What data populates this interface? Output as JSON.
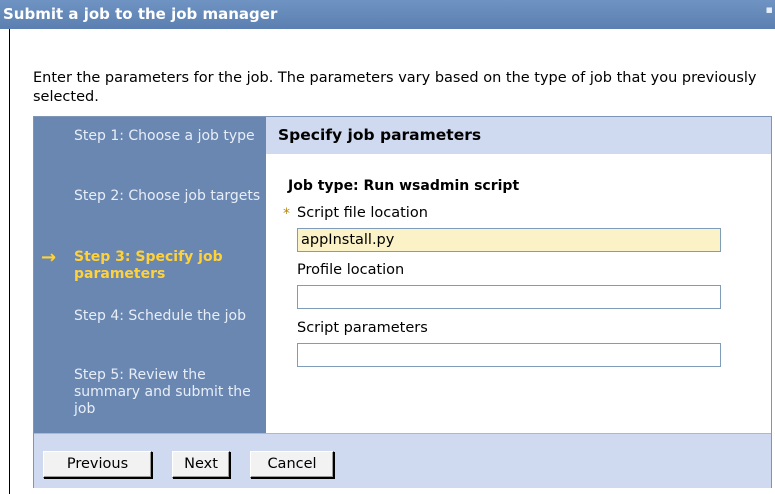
{
  "window": {
    "title": "Submit a job to the job manager"
  },
  "intro": "Enter the parameters for the job. The parameters vary based on the type of job that you previously selected.",
  "steps": [
    {
      "label": "Step 1: Choose a job type",
      "current": false
    },
    {
      "label": "Step 2: Choose job targets",
      "current": false
    },
    {
      "label": "Step 3: Specify job parameters",
      "current": true
    },
    {
      "label": "Step 4: Schedule the job",
      "current": false
    },
    {
      "label": "Step 5: Review the summary and submit the job",
      "current": false
    }
  ],
  "current_step_arrow": "→",
  "panel": {
    "heading": "Specify job parameters",
    "job_type": "Job type: Run wsadmin script",
    "required_marker": "*",
    "fields": [
      {
        "label": "Script file location",
        "value": "appInstall.py",
        "required": true
      },
      {
        "label": "Profile location",
        "value": "",
        "required": false
      },
      {
        "label": "Script parameters",
        "value": "",
        "required": false
      }
    ]
  },
  "buttons": {
    "previous": "Previous",
    "next": "Next",
    "cancel": "Cancel"
  }
}
